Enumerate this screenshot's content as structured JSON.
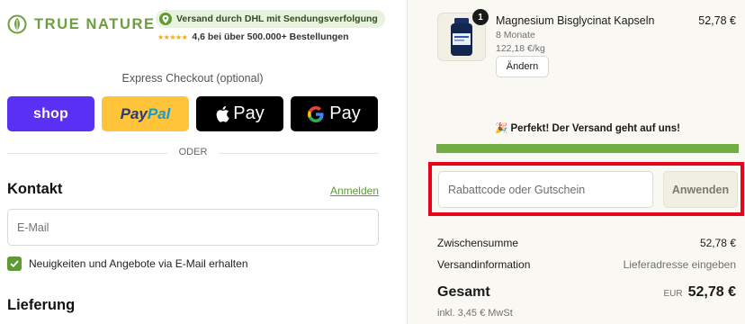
{
  "brand": {
    "name": "TRUE NATURE",
    "color": "#6d9e3f"
  },
  "trust": {
    "shipping": "Versand durch DHL mit Sendungsverfolgung",
    "stars": "★★★★★",
    "rating": "4,6 bei über 500.000+ Bestellungen"
  },
  "express": {
    "title": "Express Checkout (optional)",
    "shop": "shop",
    "paypal_part1": "Pay",
    "paypal_part2": "Pal",
    "apple": "Pay",
    "google": "Pay"
  },
  "divider": "ODER",
  "contact": {
    "title": "Kontakt",
    "login": "Anmelden",
    "email_placeholder": "E-Mail",
    "newsletter": "Neuigkeiten und Angebote via E-Mail erhalten",
    "newsletter_checked": true
  },
  "delivery": {
    "title": "Lieferung"
  },
  "cart": {
    "qty": "1",
    "name": "Magnesium Bisglycinat Kapseln",
    "variant": "8 Monate",
    "unit_price": "122,18 €/kg",
    "price": "52,78 €",
    "change": "Ändern"
  },
  "shipping_promo": {
    "message": "🎉 Perfekt! Der Versand geht auf uns!",
    "progress": 1.0
  },
  "coupon": {
    "placeholder": "Rabattcode oder Gutschein",
    "apply": "Anwenden"
  },
  "summary": {
    "subtotal_label": "Zwischensumme",
    "subtotal": "52,78 €",
    "shipping_label": "Versandinformation",
    "shipping": "Lieferadresse eingeben",
    "total_label": "Gesamt",
    "currency": "EUR",
    "total": "52,78 €",
    "tax": "inkl. 3,45 € MwSt"
  },
  "colors": {
    "accent": "#5e9b33",
    "highlight": "#e8051c",
    "shop": "#5a31f4",
    "paypal": "#ffc439"
  }
}
